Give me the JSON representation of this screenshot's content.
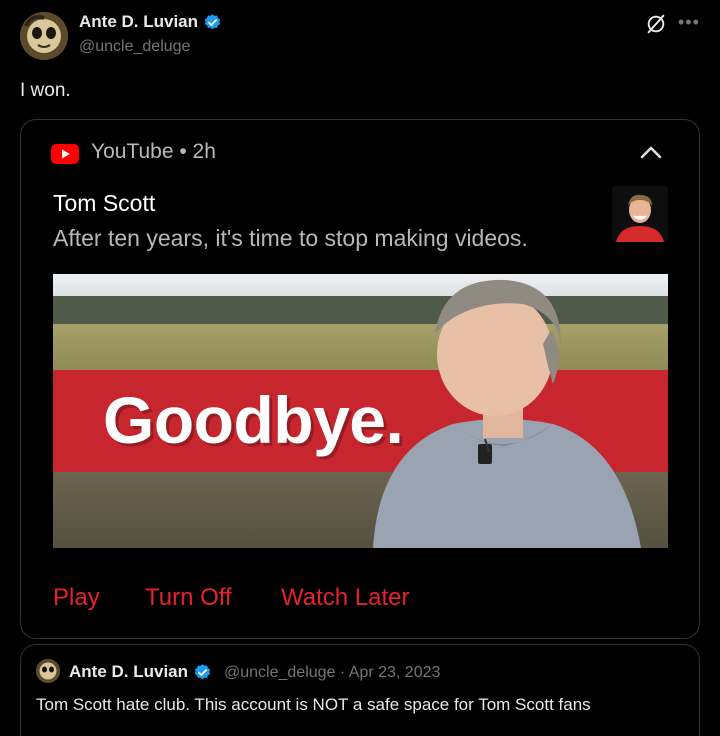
{
  "tweet": {
    "author_name": "Ante D. Luvian",
    "author_handle": "@uncle_deluge",
    "text": "I won."
  },
  "notification": {
    "app_name": "YouTube • 2h",
    "channel": "Tom Scott",
    "message": "After ten years, it's time to stop making videos.",
    "thumbnail_text": "Goodbye.",
    "actions": [
      "Play",
      "Turn Off",
      "Watch Later"
    ]
  },
  "quoted_tweet": {
    "author_name": "Ante D. Luvian",
    "meta": "@uncle_deluge · Apr 23, 2023",
    "text": "Tom Scott hate club. This account is NOT a safe space for Tom Scott fans"
  },
  "colors": {
    "background": "#000000",
    "verified_badge": "#1d9bf0",
    "action_red": "#e8222b",
    "banner_red": "#c8262f",
    "secondary_text": "#71767b"
  },
  "icons": {
    "verified": "verified-badge-icon",
    "grok": "grok-icon",
    "more": "more-icon",
    "youtube": "youtube-logo-icon",
    "collapse": "chevron-up-icon"
  }
}
